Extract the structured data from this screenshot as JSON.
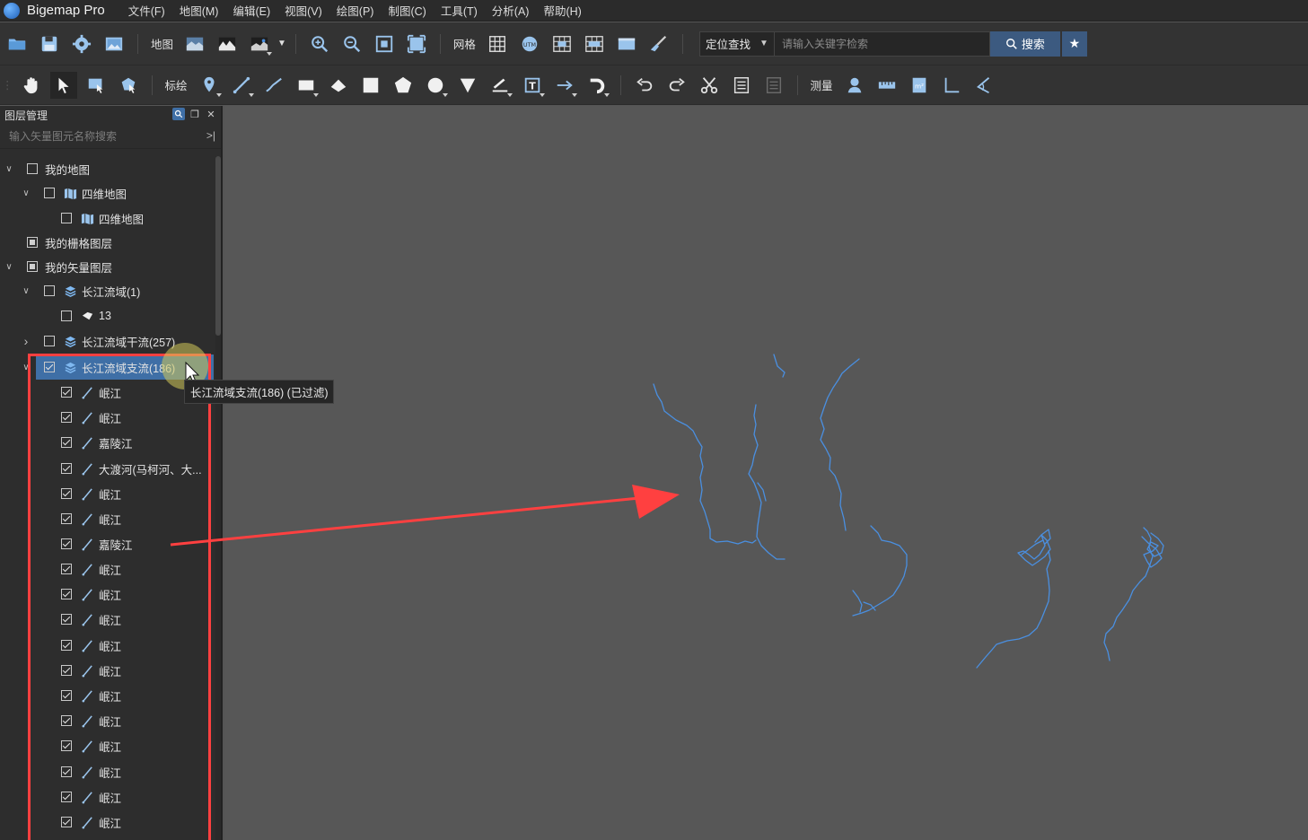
{
  "app": {
    "title": "Bigemap Pro"
  },
  "menu": {
    "items": [
      "文件(F)",
      "地图(M)",
      "编辑(E)",
      "视图(V)",
      "绘图(P)",
      "制图(C)",
      "工具(T)",
      "分析(A)",
      "帮助(H)"
    ]
  },
  "toolbar1": {
    "map_label": "地图",
    "grid_label": "网格",
    "locate_select": "定位查找",
    "search_placeholder": "请输入关键字检索",
    "search_button": "搜索"
  },
  "toolbar2": {
    "mark_label": "标绘",
    "measure_label": "测量"
  },
  "layer_panel": {
    "title": "图层管理",
    "search_placeholder": "输入矢量图元名称搜索",
    "tree": [
      {
        "label": "我的地图",
        "level": 0,
        "expander": "expanded",
        "check": "unchecked",
        "icon": "none"
      },
      {
        "label": "四维地图",
        "level": 1,
        "expander": "expanded",
        "check": "unchecked",
        "icon": "map-folder"
      },
      {
        "label": "四维地图",
        "level": 2,
        "expander": "none",
        "check": "unchecked",
        "icon": "map-layer"
      },
      {
        "label": "我的栅格图层",
        "level": 0,
        "expander": "none",
        "check": "partial",
        "icon": "none"
      },
      {
        "label": "我的矢量图层",
        "level": 0,
        "expander": "expanded",
        "check": "partial",
        "icon": "none"
      },
      {
        "label": "长江流域(1)",
        "level": 1,
        "expander": "expanded",
        "check": "unchecked",
        "icon": "layers"
      },
      {
        "label": "13",
        "level": 2,
        "expander": "none",
        "check": "unchecked",
        "icon": "polygon"
      },
      {
        "label": "长江流域干流(257)",
        "level": 1,
        "expander": "collapsed",
        "check": "unchecked",
        "icon": "layers"
      },
      {
        "label": "长江流域支流(186)",
        "level": 1,
        "expander": "expanded",
        "check": "checked",
        "icon": "layers",
        "selected": true
      },
      {
        "label": "岷江",
        "level": 2,
        "expander": "none",
        "check": "checked",
        "icon": "line"
      },
      {
        "label": "岷江",
        "level": 2,
        "expander": "none",
        "check": "checked",
        "icon": "line"
      },
      {
        "label": "嘉陵江",
        "level": 2,
        "expander": "none",
        "check": "checked",
        "icon": "line"
      },
      {
        "label": "大渡河(马柯河、大...",
        "level": 2,
        "expander": "none",
        "check": "checked",
        "icon": "line"
      },
      {
        "label": "岷江",
        "level": 2,
        "expander": "none",
        "check": "checked",
        "icon": "line"
      },
      {
        "label": "岷江",
        "level": 2,
        "expander": "none",
        "check": "checked",
        "icon": "line"
      },
      {
        "label": "嘉陵江",
        "level": 2,
        "expander": "none",
        "check": "checked",
        "icon": "line"
      },
      {
        "label": "岷江",
        "level": 2,
        "expander": "none",
        "check": "checked",
        "icon": "line"
      },
      {
        "label": "岷江",
        "level": 2,
        "expander": "none",
        "check": "checked",
        "icon": "line"
      },
      {
        "label": "岷江",
        "level": 2,
        "expander": "none",
        "check": "checked",
        "icon": "line"
      },
      {
        "label": "岷江",
        "level": 2,
        "expander": "none",
        "check": "checked",
        "icon": "line"
      },
      {
        "label": "岷江",
        "level": 2,
        "expander": "none",
        "check": "checked",
        "icon": "line"
      },
      {
        "label": "岷江",
        "level": 2,
        "expander": "none",
        "check": "checked",
        "icon": "line"
      },
      {
        "label": "岷江",
        "level": 2,
        "expander": "none",
        "check": "checked",
        "icon": "line"
      },
      {
        "label": "岷江",
        "level": 2,
        "expander": "none",
        "check": "checked",
        "icon": "line"
      },
      {
        "label": "岷江",
        "level": 2,
        "expander": "none",
        "check": "checked",
        "icon": "line"
      },
      {
        "label": "岷江",
        "level": 2,
        "expander": "none",
        "check": "checked",
        "icon": "line"
      },
      {
        "label": "岷江",
        "level": 2,
        "expander": "none",
        "check": "checked",
        "icon": "line"
      }
    ]
  },
  "tooltip": {
    "text": "长江流域支流(186) (已过滤)"
  },
  "colors": {
    "accent": "#3f6fa6",
    "river": "#4a8fe0",
    "annotation": "#ff4040"
  }
}
